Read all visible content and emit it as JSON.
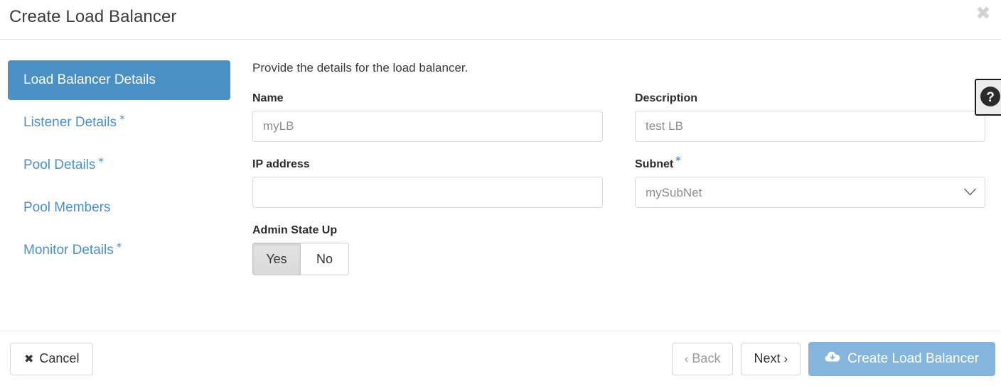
{
  "header": {
    "title": "Create Load Balancer",
    "close_icon": "close-icon"
  },
  "wizard_nav": {
    "items": [
      {
        "label": "Load Balancer Details",
        "required": false,
        "active": true
      },
      {
        "label": "Listener Details",
        "required": true,
        "active": false
      },
      {
        "label": "Pool Details",
        "required": true,
        "active": false
      },
      {
        "label": "Pool Members",
        "required": false,
        "active": false
      },
      {
        "label": "Monitor Details",
        "required": true,
        "active": false
      }
    ],
    "required_marker": "*"
  },
  "form": {
    "intro": "Provide the details for the load balancer.",
    "name": {
      "label": "Name",
      "value": "",
      "placeholder": "myLB"
    },
    "description": {
      "label": "Description",
      "value": "",
      "placeholder": "test LB"
    },
    "ip_address": {
      "label": "IP address",
      "value": "",
      "placeholder": ""
    },
    "subnet": {
      "label": "Subnet",
      "required_marker": "*",
      "selected": "mySubNet",
      "options": [
        "mySubNet"
      ],
      "chevron_icon": "chevron-down-icon"
    },
    "admin_state_up": {
      "label": "Admin State Up",
      "yes_label": "Yes",
      "no_label": "No",
      "selected": "Yes"
    },
    "help_button": {
      "icon": "help-circle-icon",
      "glyph": "?"
    }
  },
  "footer": {
    "cancel_label": "Cancel",
    "cancel_icon": "close-x-icon",
    "back_label": "Back",
    "back_chevron": "‹",
    "back_disabled": true,
    "next_label": "Next",
    "next_chevron": "›",
    "create_label": "Create Load Balancer",
    "create_icon": "cloud-download-icon"
  },
  "colors": {
    "accent_blue": "#4a90c4",
    "link_blue": "#4c8fc9",
    "primary_button": "#84b5dc",
    "border": "#d9d9d9",
    "text": "#3c3c3c"
  }
}
